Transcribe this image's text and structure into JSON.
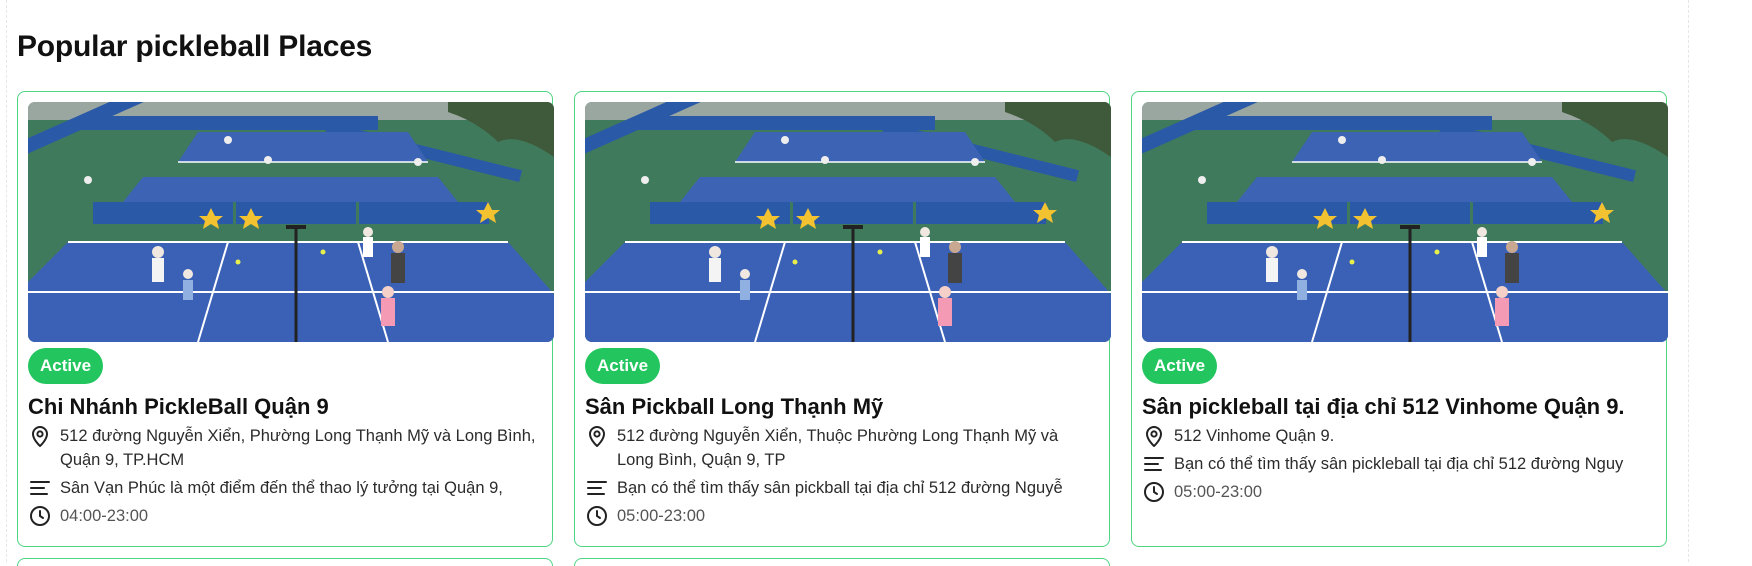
{
  "section": {
    "title": "Popular pickleball Places"
  },
  "colors": {
    "accent": "#22c55e",
    "card_border": "#4ed482"
  },
  "cards": [
    {
      "status": "Active",
      "name": "Chi Nhánh PickleBall Quận 9",
      "address": "512 đường Nguyễn Xiển, Phường Long Thạnh Mỹ và Long Bình, Quận 9, TP.HCM",
      "description": "Sân Vạn Phúc là một điểm đến thể thao lý tưởng tại Quận 9,",
      "hours": "04:00-23:00",
      "icons": [
        "map-pin-icon",
        "text-lines-icon",
        "clock-icon"
      ]
    },
    {
      "status": "Active",
      "name": "Sân Pickball Long Thạnh Mỹ",
      "address": "512 đường Nguyễn Xiển, Thuộc Phường Long Thạnh Mỹ và Long Bình, Quận 9, TP",
      "description": "Bạn có thể tìm thấy sân pickball tại địa chỉ 512 đường Nguyễ",
      "hours": "05:00-23:00",
      "icons": [
        "map-pin-icon",
        "text-lines-icon",
        "clock-icon"
      ]
    },
    {
      "status": "Active",
      "name": "Sân pickleball tại địa chỉ 512 Vinhome Quận 9.",
      "address": "512 Vinhome Quận 9.",
      "description": "Bạn có thể tìm thấy sân pickleball tại địa chỉ 512 đường Nguy",
      "hours": "05:00-23:00",
      "icons": [
        "map-pin-icon",
        "text-lines-icon",
        "clock-icon"
      ]
    }
  ]
}
